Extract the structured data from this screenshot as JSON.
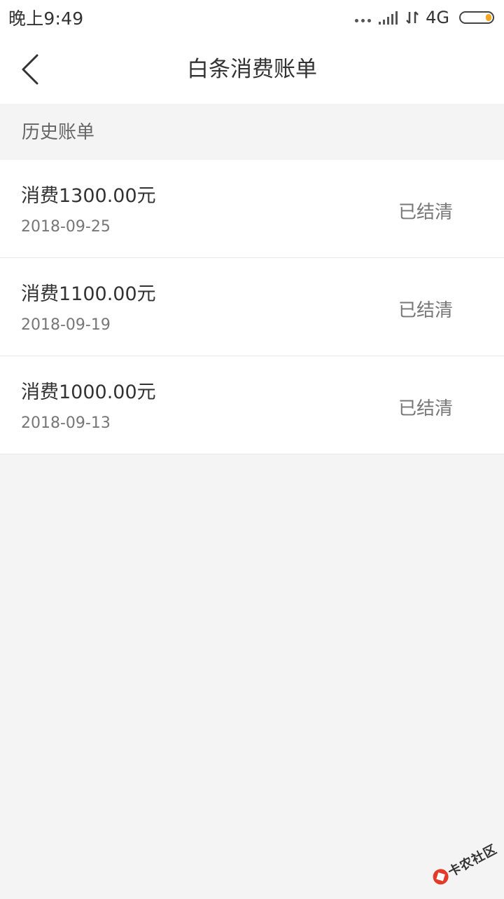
{
  "status_bar": {
    "time": "晚上9:49",
    "network_type": "4G",
    "battery_level": 0.2,
    "accent_color": "#f5a623"
  },
  "header": {
    "title": "白条消费账单",
    "back_icon": "chevron-left-icon"
  },
  "section": {
    "title": "历史账单"
  },
  "bills": [
    {
      "amount": "消费1300.00元",
      "date": "2018-09-25",
      "status": "已结清"
    },
    {
      "amount": "消费1100.00元",
      "date": "2018-09-19",
      "status": "已结清"
    },
    {
      "amount": "消费1000.00元",
      "date": "2018-09-13",
      "status": "已结清"
    }
  ],
  "watermark": {
    "text": "卡农社区"
  }
}
